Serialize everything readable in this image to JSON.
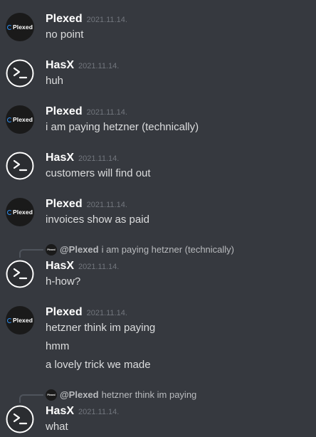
{
  "colors": {
    "background": "#36393f",
    "author_name": "#ffffff",
    "timestamp": "#72767d",
    "message_text": "#dcddde",
    "reply_text": "#b9bbbe",
    "plexed_logo_accent": "#2e8ff2"
  },
  "avatars": {
    "plexed_logo_text": "Plexed",
    "hasx_icon": "terminal-prompt-icon"
  },
  "messages": [
    {
      "author": "Plexed",
      "timestamp": "2021.11.14.",
      "lines": [
        "no point"
      ]
    },
    {
      "author": "HasX",
      "timestamp": "2021.11.14.",
      "lines": [
        "huh"
      ]
    },
    {
      "author": "Plexed",
      "timestamp": "2021.11.14.",
      "lines": [
        "i am paying hetzner (technically)"
      ]
    },
    {
      "author": "HasX",
      "timestamp": "2021.11.14.",
      "lines": [
        "customers will find out"
      ]
    },
    {
      "author": "Plexed",
      "timestamp": "2021.11.14.",
      "lines": [
        "invoices show as paid"
      ]
    },
    {
      "reply": {
        "author": "@Plexed",
        "text": "i am paying hetzner (technically)"
      },
      "author": "HasX",
      "timestamp": "2021.11.14.",
      "lines": [
        "h-how?"
      ]
    },
    {
      "author": "Plexed",
      "timestamp": "2021.11.14.",
      "lines": [
        "hetzner think im paying",
        "hmm",
        "a lovely trick we made"
      ]
    },
    {
      "reply": {
        "author": "@Plexed",
        "text": "hetzner think im paying"
      },
      "author": "HasX",
      "timestamp": "2021.11.14.",
      "lines": [
        "what"
      ]
    }
  ]
}
